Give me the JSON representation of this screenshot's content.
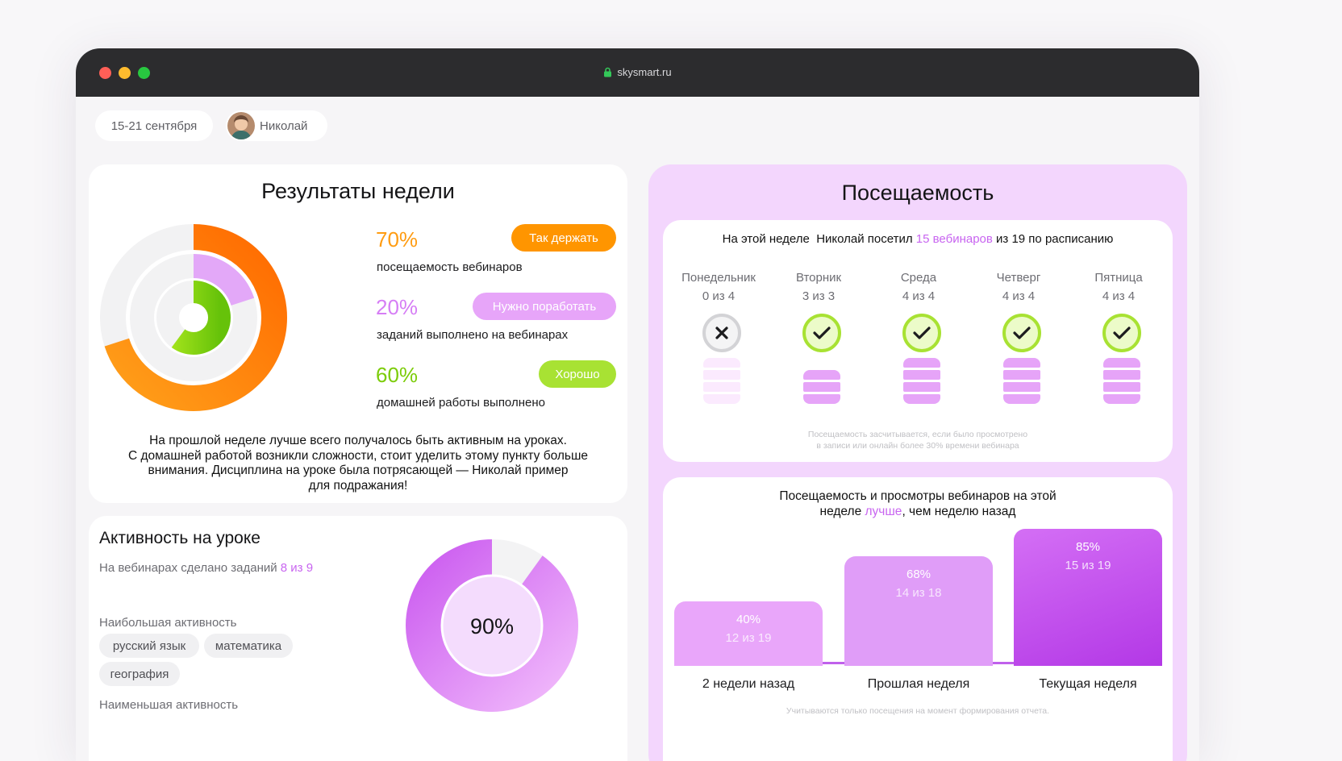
{
  "browser": {
    "url": "skysmart.ru"
  },
  "header": {
    "date_range": "15-21 сентября",
    "student_name": "Николай"
  },
  "week_results": {
    "title": "Результаты недели",
    "metrics": [
      {
        "value": "70%",
        "caption": "посещаемость вебинаров",
        "badge": "Так держать",
        "color": "#ff8a00"
      },
      {
        "value": "20%",
        "caption": "заданий выполнено на вебинарах",
        "badge": "Нужно поработать",
        "color": "#d67ef5"
      },
      {
        "value": "60%",
        "caption": "домашней работы выполнено",
        "badge": "Хорошо",
        "color": "#84d40a"
      }
    ],
    "summary": [
      "На прошлой неделе лучше всего получалось быть активным на уроках.",
      "С домашней работой возникли сложности, стоит уделить этому пункту больше",
      "внимания. Дисциплина на уроке была потрясающей — Николай пример",
      "для подражания!"
    ]
  },
  "activity": {
    "title": "Активность на уроке",
    "tasks_prefix": "На вебинарах сделано заданий",
    "tasks_value": "8 из 9",
    "most_label": "Наибольшая активность",
    "most_tags": [
      "русский язык",
      "математика",
      "география"
    ],
    "least_label": "Наименьшая активность",
    "donut_value": "90%",
    "donut_fraction": 0.9
  },
  "attendance": {
    "title": "Посещаемость",
    "summary_prefix": "На этой неделе  Николай посетил",
    "summary_highlight": "15 вебинаров",
    "summary_suffix": "из 19 по расписанию",
    "days": [
      {
        "name": "Понедельник",
        "count": "0 из 4",
        "attended": 0,
        "total": 4,
        "ok": false
      },
      {
        "name": "Вторник",
        "count": "3 из 3",
        "attended": 3,
        "total": 3,
        "ok": true
      },
      {
        "name": "Среда",
        "count": "4 из 4",
        "attended": 4,
        "total": 4,
        "ok": true
      },
      {
        "name": "Четверг",
        "count": "4 из 4",
        "attended": 4,
        "total": 4,
        "ok": true
      },
      {
        "name": "Пятница",
        "count": "4 из 4",
        "attended": 4,
        "total": 4,
        "ok": true
      }
    ],
    "note_line1": "Посещаемость засчитывается, если было просмотрено",
    "note_line2": "в записи или онлайн более 30% времени вебинара",
    "compare_line1": "Посещаемость и просмотры вебинаров на этой",
    "compare_line2_prefix": "неделе",
    "compare_highlight": "лучше",
    "compare_line2_suffix": ", чем неделю назад",
    "bars": [
      {
        "label": "2 недели назад",
        "pct": "40%",
        "count": "12 из 19",
        "value": 40
      },
      {
        "label": "Прошлая неделя",
        "pct": "68%",
        "count": "14 из 18",
        "value": 68
      },
      {
        "label": "Текущая неделя",
        "pct": "85%",
        "count": "15 из 19",
        "value": 85
      }
    ],
    "bottom_note": "Учитываются только посещения на момент формирования отчета."
  }
}
